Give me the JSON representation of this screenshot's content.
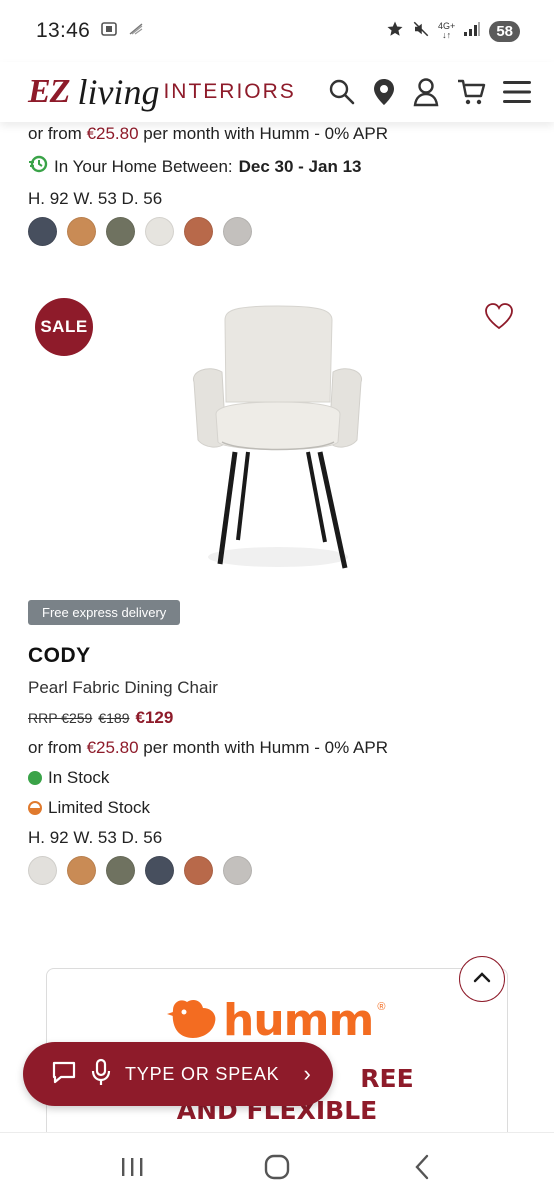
{
  "status_bar": {
    "time": "13:46",
    "network": "4G+",
    "battery": "58"
  },
  "header": {
    "logo_ez": "EZ",
    "logo_living": "living",
    "logo_interiors": "INTERIORS"
  },
  "prev_product": {
    "finance_prefix": "or from ",
    "finance_amount": "€25.80",
    "finance_suffix": " per month with Humm - 0% APR",
    "delivery_prefix": "In Your Home Between: ",
    "delivery_dates": "Dec 30 - Jan 13",
    "dimensions": "H. 92  W. 53  D. 56",
    "swatches": [
      "#474f5e",
      "#c98b55",
      "#6f7260",
      "#e6e4df",
      "#b8694a",
      "#c3c0bd"
    ]
  },
  "product": {
    "sale_badge": "SALE",
    "delivery_badge": "Free express delivery",
    "name": "CODY",
    "subtitle": "Pearl Fabric Dining Chair",
    "rrp": "RRP €259",
    "was_price": "€189",
    "price": "€129",
    "finance_prefix": "or from ",
    "finance_amount": "€25.80",
    "finance_suffix": " per month with Humm - 0% APR",
    "stock_status": "In Stock",
    "limited_status": "Limited Stock",
    "dimensions": "H. 92  W. 53  D. 56",
    "swatches": [
      "#e2e0dc",
      "#c98b55",
      "#6f7260",
      "#474f5e",
      "#b8694a",
      "#c3c0bd"
    ]
  },
  "humm_banner": {
    "logo_text": "humm",
    "reg": "®",
    "tag_line1": "REE",
    "tag_line2": "AND FLEXIBLE"
  },
  "voice_assistant": {
    "label": "TYPE OR SPEAK",
    "chevron": "›"
  },
  "colors": {
    "brand": "#8e1b2a",
    "humm_orange": "#f36c21",
    "in_stock": "#3aa348",
    "limited_stock": "#e07a2e"
  }
}
